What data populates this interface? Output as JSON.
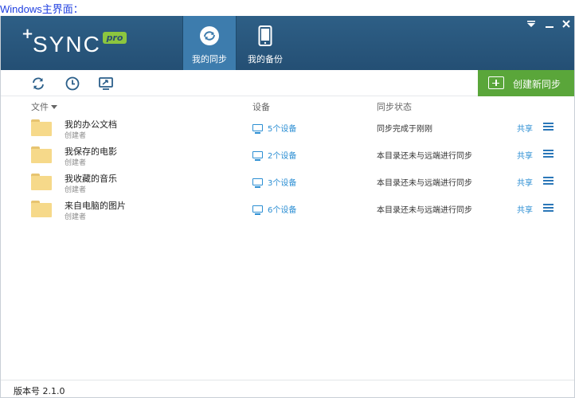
{
  "caption": "Windows主界面：",
  "logo": {
    "plus": "+",
    "name": "SYNC",
    "badge": "pro"
  },
  "nav": {
    "tab_sync": "我的同步",
    "tab_backup": "我的备份"
  },
  "toolbar": {
    "create_label": "创建新同步"
  },
  "columns": {
    "file": "文件",
    "devices": "设备",
    "status": "同步状态"
  },
  "rows": [
    {
      "name": "我的办公文档",
      "role": "创建者",
      "devices": "5个设备",
      "status": "同步完成于刚刚",
      "share": "共享"
    },
    {
      "name": "我保存的电影",
      "role": "创建者",
      "devices": "2个设备",
      "status": "本目录还未与远端进行同步",
      "share": "共享"
    },
    {
      "name": "我收藏的音乐",
      "role": "创建者",
      "devices": "3个设备",
      "status": "本目录还未与远端进行同步",
      "share": "共享"
    },
    {
      "name": "来自电脑的图片",
      "role": "创建者",
      "devices": "6个设备",
      "status": "本目录还未与远端进行同步",
      "share": "共享"
    }
  ],
  "footer": {
    "version": "版本号 2.1.0"
  },
  "colors": {
    "header": "#2a5a80",
    "accent_green": "#5aa63a",
    "link_blue": "#2b8ed3",
    "folder": "#f6d98a"
  },
  "icons": [
    "refresh-icon",
    "clock-icon",
    "monitor-sync-icon",
    "cloud-sync-icon",
    "phone-icon",
    "dropdown-icon",
    "minimize-icon",
    "close-icon",
    "folder-icon",
    "monitor-icon",
    "hamburger-menu-icon"
  ]
}
